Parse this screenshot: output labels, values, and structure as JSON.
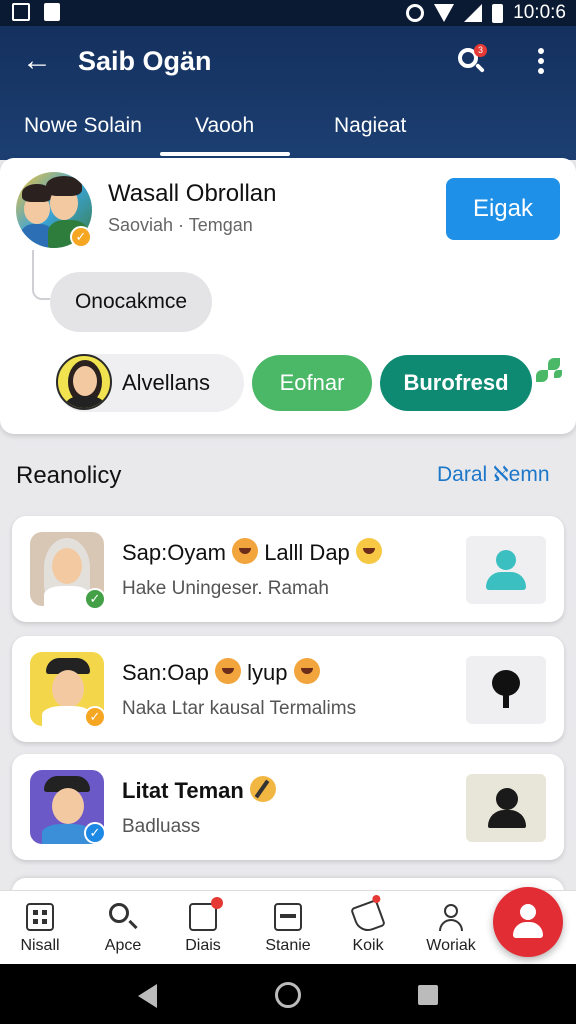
{
  "status_bar": {
    "time": "10:0:6"
  },
  "header": {
    "title": "Saib Ogän",
    "search_badge": "3"
  },
  "tabs": [
    {
      "label": "Nowe Solain"
    },
    {
      "label": "Vaooh",
      "active": true
    },
    {
      "label": "Nagieat"
    }
  ],
  "featured": {
    "name": "Wasall Obrollan",
    "subtitle": "Saoviah · Temgan",
    "action_label": "Eigak",
    "reply_label": "Onocakmce",
    "chips": {
      "person": "Alvellans",
      "green": "Eofnar",
      "teal": "Burofresd"
    }
  },
  "section": {
    "title": "Reanolicy",
    "link": "Daral ℵemn"
  },
  "list": [
    {
      "title": "Sap:Oyam",
      "title_suffix": "Lalll Dap",
      "subtitle": "Hake Uningeser. Ramah",
      "icon": "person-icon"
    },
    {
      "title": "San:Oap",
      "title_suffix": "lyup",
      "subtitle": "Naka Ltar kausal Termalims",
      "icon": "key-icon"
    },
    {
      "title": "Litat Teman",
      "title_suffix": "",
      "subtitle": "Badluass",
      "icon": "person-icon"
    }
  ],
  "bottom_nav": [
    {
      "label": "Nisall",
      "icon": "grid-icon"
    },
    {
      "label": "Apce",
      "icon": "search-icon"
    },
    {
      "label": "Diais",
      "icon": "calendar-icon"
    },
    {
      "label": "Stanie",
      "icon": "box-icon"
    },
    {
      "label": "Koik",
      "icon": "tag-icon"
    },
    {
      "label": "Woriak",
      "icon": "user-icon"
    }
  ],
  "colors": {
    "header": "#1c3f72",
    "primary_button": "#1e90e8",
    "green_chip": "#4ab867",
    "teal_chip": "#0f8a72",
    "fab": "#e32d35",
    "link": "#1d77c9"
  }
}
